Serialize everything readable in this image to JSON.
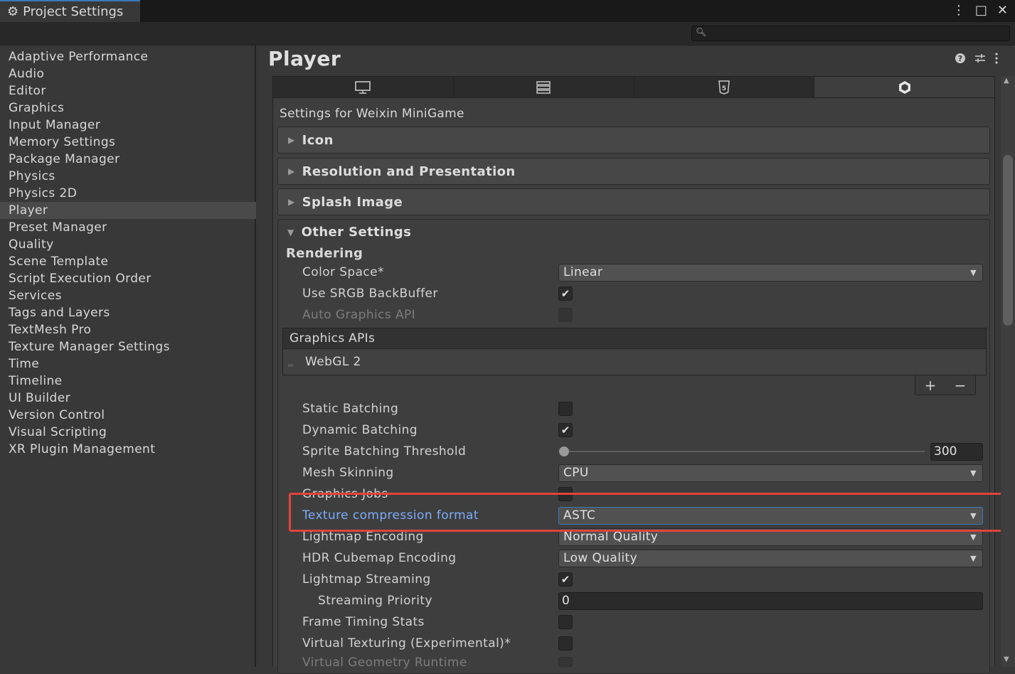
{
  "window": {
    "tab_title": "Project Settings",
    "menu_glyph": "⋮",
    "maximize_glyph": "□",
    "close_glyph": "✕"
  },
  "sidebar": {
    "items": [
      {
        "label": "Adaptive Performance",
        "selected": false
      },
      {
        "label": "Audio",
        "selected": false
      },
      {
        "label": "Editor",
        "selected": false
      },
      {
        "label": "Graphics",
        "selected": false
      },
      {
        "label": "Input Manager",
        "selected": false
      },
      {
        "label": "Memory Settings",
        "selected": false
      },
      {
        "label": "Package Manager",
        "selected": false
      },
      {
        "label": "Physics",
        "selected": false
      },
      {
        "label": "Physics 2D",
        "selected": false
      },
      {
        "label": "Player",
        "selected": true
      },
      {
        "label": "Preset Manager",
        "selected": false
      },
      {
        "label": "Quality",
        "selected": false
      },
      {
        "label": "Scene Template",
        "selected": false
      },
      {
        "label": "Script Execution Order",
        "selected": false
      },
      {
        "label": "Services",
        "selected": false
      },
      {
        "label": "Tags and Layers",
        "selected": false
      },
      {
        "label": "TextMesh Pro",
        "selected": false
      },
      {
        "label": "Texture Manager Settings",
        "selected": false
      },
      {
        "label": "Time",
        "selected": false
      },
      {
        "label": "Timeline",
        "selected": false
      },
      {
        "label": "UI Builder",
        "selected": false
      },
      {
        "label": "Version Control",
        "selected": false
      },
      {
        "label": "Visual Scripting",
        "selected": false
      },
      {
        "label": "XR Plugin Management",
        "selected": false
      }
    ]
  },
  "main": {
    "title": "Player",
    "settings_for": "Settings for Weixin MiniGame",
    "platform_tabs": [
      "monitor-icon",
      "server-icon",
      "html5-icon",
      "minigame-cube-icon"
    ],
    "foldouts": {
      "icon": "Icon",
      "resolution": "Resolution and Presentation",
      "splash": "Splash Image",
      "other": "Other Settings"
    },
    "rendering_header": "Rendering",
    "color_space": {
      "label": "Color Space*",
      "value": "Linear"
    },
    "use_srgb": {
      "label": "Use SRGB BackBuffer",
      "checked": true
    },
    "auto_graphics_api": {
      "label": "Auto Graphics API",
      "checked": false
    },
    "graphics_apis": {
      "header": "Graphics APIs",
      "items": [
        "WebGL 2"
      ],
      "add": "+",
      "remove": "−"
    },
    "static_batching": {
      "label": "Static Batching",
      "checked": false
    },
    "dynamic_batching": {
      "label": "Dynamic Batching",
      "checked": true
    },
    "sprite_batching_threshold": {
      "label": "Sprite Batching Threshold",
      "value": "300"
    },
    "mesh_skinning": {
      "label": "Mesh Skinning",
      "value": "CPU"
    },
    "graphics_jobs": {
      "label": "Graphics Jobs",
      "checked": false
    },
    "texture_compression": {
      "label": "Texture compression format",
      "value": "ASTC"
    },
    "lightmap_encoding": {
      "label": "Lightmap Encoding",
      "value": "Normal Quality"
    },
    "hdr_cubemap": {
      "label": "HDR Cubemap Encoding",
      "value": "Low Quality"
    },
    "lightmap_streaming": {
      "label": "Lightmap Streaming",
      "checked": true
    },
    "streaming_priority": {
      "label": "Streaming Priority",
      "value": "0"
    },
    "frame_timing": {
      "label": "Frame Timing Stats",
      "checked": false
    },
    "virtual_texturing": {
      "label": "Virtual Texturing (Experimental)*",
      "checked": false
    },
    "virtual_geometry": {
      "label": "Virtual Geometry Runtime",
      "checked": false
    }
  },
  "colors": {
    "accent": "#3a79bb",
    "highlight": "#e0443a",
    "focused_label": "#7cacf8"
  }
}
